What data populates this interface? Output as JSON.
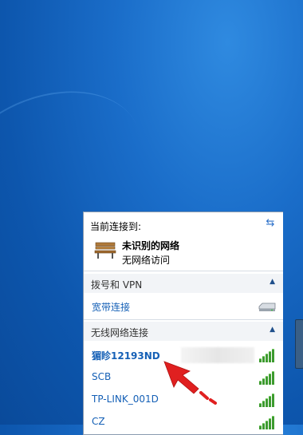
{
  "popup": {
    "header": "当前连接到:",
    "refresh_icon": "refresh-icon",
    "current_network": {
      "name": "未识别的网络",
      "status": "无网络访问",
      "icon": "bench-icon"
    },
    "sections": [
      {
        "label": "拨号和 VPN",
        "items": [
          {
            "name": "宽带连接",
            "icon": "modem-icon"
          }
        ]
      },
      {
        "label": "无线网络连接",
        "items": [
          {
            "name": "猸眕12193ND",
            "bold": true,
            "signal_bars": 5
          },
          {
            "name": "SCB",
            "signal_bars": 5
          },
          {
            "name": "TP-LINK_001D",
            "signal_bars": 5
          },
          {
            "name": "CZ",
            "signal_bars": 5
          }
        ]
      }
    ]
  },
  "colors": {
    "desktop": "#1a6dc9",
    "link": "#1560b6",
    "signal": "#3d9b2f",
    "arrow": "#e02020"
  }
}
